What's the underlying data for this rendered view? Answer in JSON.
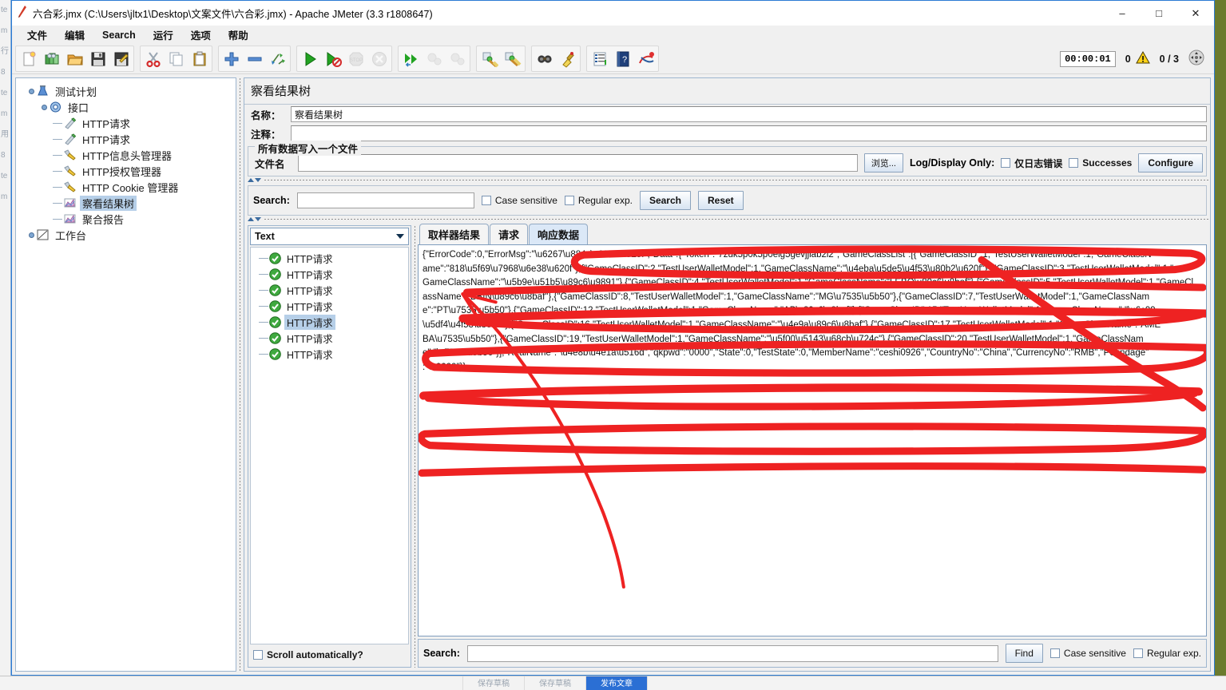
{
  "window": {
    "title": "六合彩.jmx (C:\\Users\\jltx1\\Desktop\\文案文件\\六合彩.jmx) - Apache JMeter (3.3 r1808647)",
    "app_icon": "jmeter-feather-icon",
    "minimize": "–",
    "maximize": "□",
    "close": "✕"
  },
  "menubar": {
    "items": [
      {
        "label": "文件",
        "name": "menu-file"
      },
      {
        "label": "编辑",
        "name": "menu-edit"
      },
      {
        "label": "Search",
        "name": "menu-search"
      },
      {
        "label": "运行",
        "name": "menu-run"
      },
      {
        "label": "选项",
        "name": "menu-options"
      },
      {
        "label": "帮助",
        "name": "menu-help"
      }
    ]
  },
  "toolbar": {
    "groups": [
      [
        "new-icon",
        "templates-icon",
        "open-icon",
        "save-icon",
        "save-as-icon"
      ],
      [
        "cut-icon",
        "copy-icon",
        "paste-icon"
      ],
      [
        "add-icon",
        "remove-icon",
        "toggle-icon"
      ],
      [
        "start-icon",
        "start-no-timers-icon",
        "stop-icon",
        "shutdown-icon"
      ],
      [
        "remote-start-all-icon",
        "remote-stop-all-icon",
        "remote-shutdown-all-icon"
      ],
      [
        "clear-icon",
        "clear-all-icon"
      ],
      [
        "search-icon",
        "search-reset-icon"
      ],
      [
        "function-helper-icon",
        "help-icon",
        "undo-redo-icon"
      ]
    ],
    "timer": "00:00:01",
    "warning_count": "0",
    "thread_count": "0 / 3",
    "expand_icon": "expand-icon"
  },
  "tree": {
    "nodes": [
      {
        "label": "测试计划",
        "icon": "test-plan-icon",
        "depth": 0,
        "selected": false
      },
      {
        "label": "接口",
        "icon": "thread-group-icon",
        "depth": 1,
        "selected": false
      },
      {
        "label": "HTTP请求",
        "icon": "http-sampler-icon",
        "depth": 2,
        "selected": false
      },
      {
        "label": "HTTP请求",
        "icon": "http-sampler-icon",
        "depth": 2,
        "selected": false
      },
      {
        "label": "HTTP信息头管理器",
        "icon": "header-manager-icon",
        "depth": 2,
        "selected": false
      },
      {
        "label": "HTTP授权管理器",
        "icon": "auth-manager-icon",
        "depth": 2,
        "selected": false
      },
      {
        "label": "HTTP Cookie 管理器",
        "icon": "cookie-manager-icon",
        "depth": 2,
        "selected": false
      },
      {
        "label": "察看结果树",
        "icon": "view-results-tree-icon",
        "depth": 2,
        "selected": true
      },
      {
        "label": "聚合报告",
        "icon": "aggregate-report-icon",
        "depth": 2,
        "selected": false
      },
      {
        "label": "工作台",
        "icon": "workbench-icon",
        "depth": 0,
        "selected": false
      }
    ]
  },
  "panel": {
    "title": "察看结果树",
    "name_label": "名称：",
    "name_value": "察看结果树",
    "comment_label": "注释：",
    "comment_value": "",
    "file_group_legend": "所有数据写入一个文件",
    "filename_label": "文件名",
    "filename_value": "",
    "filename_placeholder": "",
    "browse_button": "浏览...",
    "log_display_label": "Log/Display Only:",
    "errors_only_checkbox": "仅日志错误",
    "successes_checkbox": "Successes",
    "configure_button": "Configure"
  },
  "search_bar": {
    "label": "Search:",
    "value": "",
    "case_sensitive": "Case sensitive",
    "regular_exp": "Regular exp.",
    "search_button": "Search",
    "reset_button": "Reset"
  },
  "results": {
    "render_selector": "Text",
    "items": [
      {
        "label": "HTTP请求",
        "status": "success",
        "selected": false
      },
      {
        "label": "HTTP请求",
        "status": "success",
        "selected": false
      },
      {
        "label": "HTTP请求",
        "status": "success",
        "selected": false
      },
      {
        "label": "HTTP请求",
        "status": "success",
        "selected": false
      },
      {
        "label": "HTTP请求",
        "status": "success",
        "selected": true
      },
      {
        "label": "HTTP请求",
        "status": "success",
        "selected": false
      },
      {
        "label": "HTTP请求",
        "status": "success",
        "selected": false
      }
    ],
    "scroll_automatically": "Scroll automatically?"
  },
  "detail_tabs": [
    {
      "label": "取样器结果",
      "active": false,
      "name": "tab-sampler-result"
    },
    {
      "label": "请求",
      "active": false,
      "name": "tab-request"
    },
    {
      "label": "响应数据",
      "active": true,
      "name": "tab-response-data"
    }
  ],
  "response": {
    "lines": [
      "{\"ErrorCode\":0,\"ErrorMsg\":\"\\u6267\\u884c\\u6210\\u529f\",\"Data\":{\"Token\":\"7zuk5p0k5p0elg5gevjjlab2l2\",\"GameClassList\":[{\"GameClassID\":1,\"TestUserWalletModel\":1,\"GameClassN",
      "ame\":\"818\\u5f69\\u7968\\u6e38\\u620f\"},{\"GameClassID\":2,\"TestUserWalletModel\":1,\"GameClassName\":\"\\u4eba\\u5de5\\u4f53\\u80b2\\u620f\"},{\"GameClassID\":3,\"TestUserWalletModel\":1,\"",
      "GameClassName\":\"\\u5b9e\\u51b5\\u89c6\\u9891\"},{\"GameClassID\":4,\"TestUserWalletModel\":1,\"GameClassName\":\"LEBO\\u89c6\\u8baf\"},{\"GameClassID\":5,\"TestUserWalletModel\":1,\"GameCl",
      "assName\":\"BBIN\\u89c6\\u8baf\"},{\"GameClassID\":8,\"TestUserWalletModel\":1,\"GameClassName\":\"MG\\u7535\\u5b50\"},{\"GameClassID\":7,\"TestUserWalletModel\":1,\"GameClassNam",
      "e\":\"PT\\u7535\\u5b50\"},{\"GameClassID\":12,\"TestUserWalletModel\":1,\"GameClassName\":\"AB\\u89c6\\u8baf\"},{\"GameClassID\":15,\"TestUserWalletModel\":1,\"GameClassName\":\"\\u6c99",
      "\\u5df4\\u4f53\\u80b2\"},{\"GameClassID\":16,\"TestUserWalletModel\":1,\"GameClassName\":\"\\u4e9a\\u89c6\\u8baf\"},{\"GameClassID\":17,\"TestUserWalletModel\":1,\"GameClassName\":\"AME",
      "BA\\u7535\\u5b50\"},{\"GameClassID\":19,\"TestUserWalletModel\":1,\"GameClassName\":\"\\u5f00\\u5143\\u68cb\\u724c\"},{\"GameClassID\":20,\"TestUserWalletModel\":1,\"GameClassNam",
      "e\":\"\\u7535\\u5b50\"}],\"RealName\":\"\\u4e8b\\u4e1a\\u516d\",\"qkpwd\":\"0000\",\"State\":0,\"TestState\":0,\"MemberName\":\"ceshi0926\",\"CountryNo\":\"China\",\"CurrencyNo\":\"RMB\",\"Poundage\"",
      ":\"0.0000\"}}"
    ]
  },
  "find_bar": {
    "label": "Search:",
    "value": "",
    "find_button": "Find",
    "case_sensitive": "Case sensitive",
    "regular_exp": "Regular exp."
  },
  "taskbar": {
    "items": [
      {
        "label": "保存草稿",
        "active": false
      },
      {
        "label": "保存草稿",
        "active": false
      },
      {
        "label": "发布文章",
        "active": true
      }
    ]
  },
  "background_window": {
    "fragments": [
      "te",
      "m",
      "行",
      "8",
      "te",
      "m",
      "用",
      "8",
      "te",
      "m"
    ]
  },
  "colors": {
    "accent": "#2b7bd4",
    "selection": "#b6cfe8",
    "annotation": "#ee2222",
    "desktop": "#6b7b2e"
  }
}
